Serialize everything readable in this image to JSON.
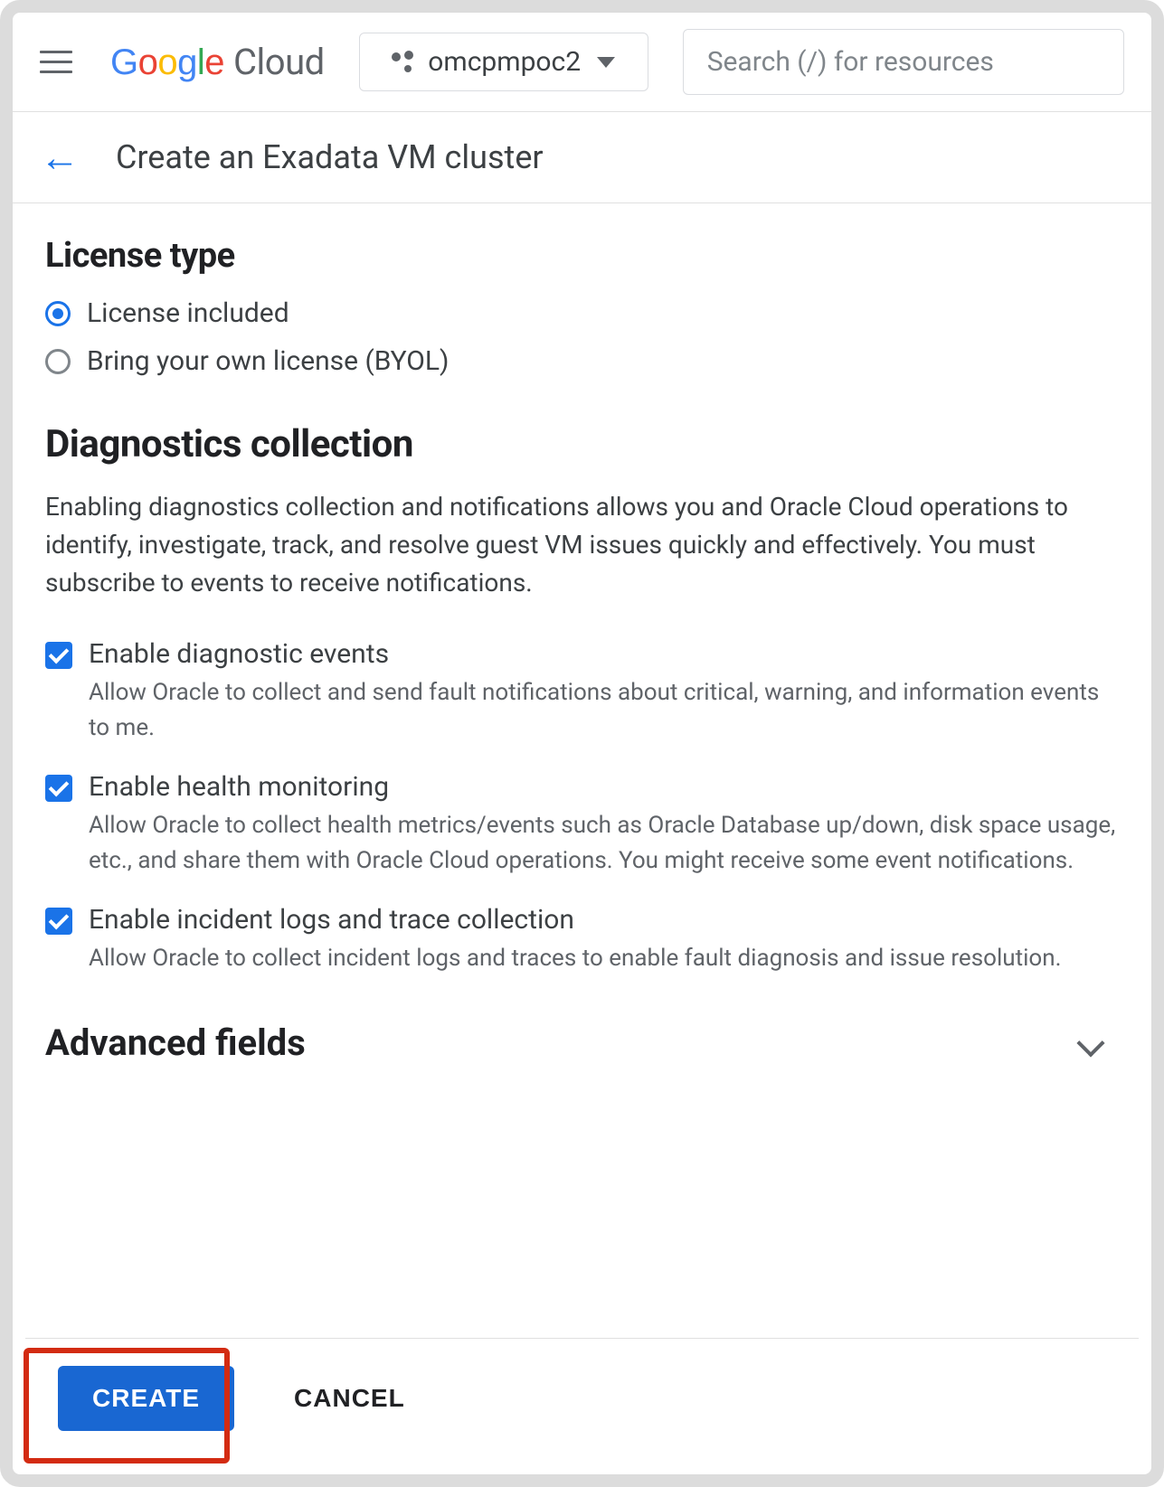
{
  "header": {
    "logo_word": {
      "g1": "G",
      "o1": "o",
      "o2": "o",
      "g2": "g",
      "l": "l",
      "e": "e"
    },
    "logo_cloud": "Cloud",
    "project_name": "omcpmpoc2",
    "search_placeholder": "Search (/) for resources"
  },
  "page": {
    "title": "Create an Exadata VM cluster"
  },
  "license": {
    "heading": "License type",
    "options": [
      {
        "id": "license-included",
        "label": "License included",
        "checked": true
      },
      {
        "id": "byol",
        "label": "Bring your own license (BYOL)",
        "checked": false
      }
    ]
  },
  "diag": {
    "heading": "Diagnostics collection",
    "description": "Enabling diagnostics collection and notifications allows you and Oracle Cloud operations to identify, investigate, track, and resolve guest VM issues quickly and effectively. You must subscribe to events to receive notifications.",
    "checks": [
      {
        "id": "diag-events",
        "label": "Enable diagnostic events",
        "sub": "Allow Oracle to collect and send fault notifications about critical, warning, and information events to me.",
        "checked": true
      },
      {
        "id": "health-mon",
        "label": "Enable health monitoring",
        "sub": "Allow Oracle to collect health metrics/events such as Oracle Database up/down, disk space usage, etc., and share them with Oracle Cloud operations. You might receive some event notifications.",
        "checked": true
      },
      {
        "id": "incident-logs",
        "label": "Enable incident logs and trace collection",
        "sub": "Allow Oracle to collect incident logs and traces to enable fault diagnosis and issue resolution.",
        "checked": true
      }
    ]
  },
  "advanced": {
    "heading": "Advanced fields"
  },
  "footer": {
    "create": "CREATE",
    "cancel": "CANCEL"
  }
}
